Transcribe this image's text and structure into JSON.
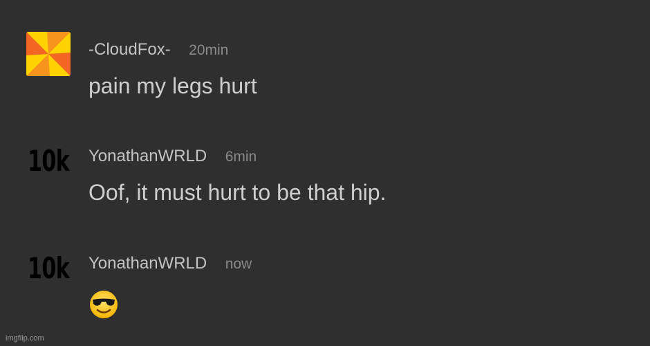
{
  "comments": [
    {
      "avatar": {
        "type": "image",
        "icon": "pinwheel-avatar-icon",
        "colors": [
          "#f7941d",
          "#ffd200"
        ]
      },
      "username": "-CloudFox-",
      "time": "20min",
      "message": "pain my legs hurt"
    },
    {
      "avatar": {
        "type": "text",
        "text": "10k"
      },
      "username": "YonathanWRLD",
      "time": "6min",
      "message": "Oof, it must hurt to be that hip."
    },
    {
      "avatar": {
        "type": "text",
        "text": "10k"
      },
      "username": "YonathanWRLD",
      "time": "now",
      "emoji": "smiling-face-with-sunglasses-icon"
    }
  ],
  "watermark": "imgflip.com",
  "colors": {
    "background": "#2f2f2f",
    "username": "#c3c3c3",
    "timestamp": "#8a8a8a",
    "message": "#cfcfcf"
  }
}
